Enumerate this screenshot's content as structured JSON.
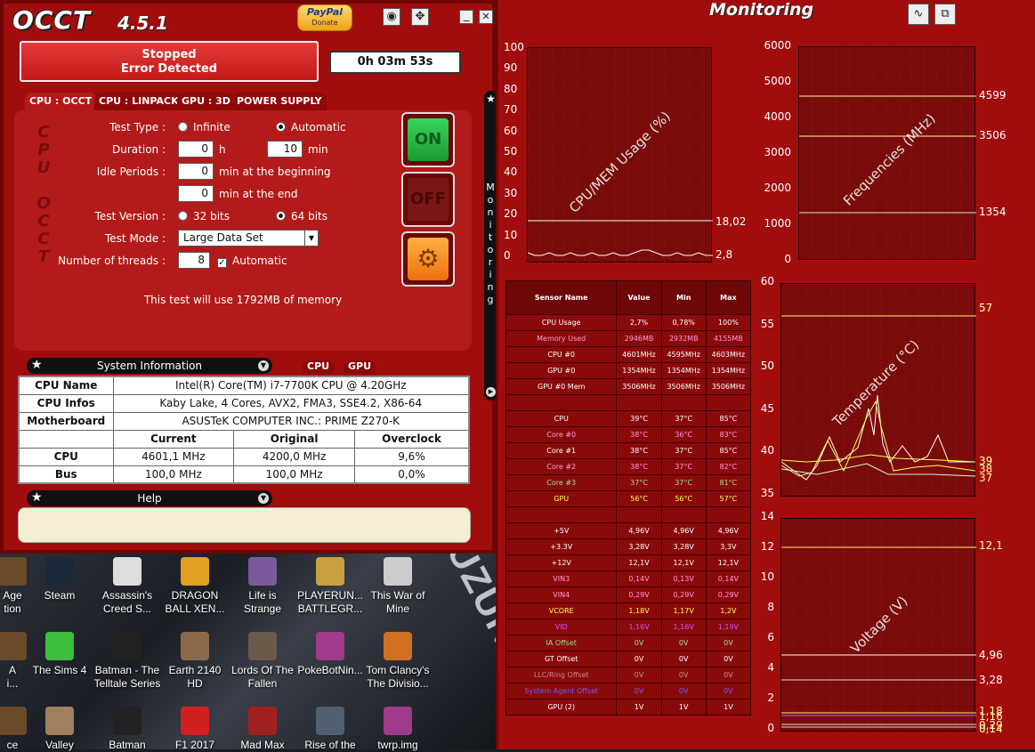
{
  "app": {
    "logo": "OCCT",
    "version": "4.5.1",
    "paypal": {
      "brand": "PayPal",
      "label": "Donate"
    },
    "status": {
      "line1": "Stopped",
      "line2": "Error Detected"
    },
    "timer": "0h 03m 53s",
    "tabs": [
      "CPU : OCCT",
      "CPU : LINPACK",
      "GPU : 3D",
      "POWER SUPPLY"
    ],
    "side_title": "CPU OCCT",
    "form": {
      "test_type_label": "Test Type :",
      "test_type_options": [
        "Infinite",
        "Automatic"
      ],
      "duration_label": "Duration :",
      "duration_hours": "0",
      "duration_h_unit": "h",
      "duration_minutes": "10",
      "duration_min_unit": "min",
      "idle_label": "Idle Periods :",
      "idle_begin": "0",
      "idle_begin_unit": "min at the beginning",
      "idle_end": "0",
      "idle_end_unit": "min at the end",
      "version_label": "Test Version :",
      "version_options": [
        "32 bits",
        "64 bits"
      ],
      "mode_label": "Test Mode :",
      "mode_value": "Large Data Set",
      "threads_label": "Number of threads :",
      "threads_value": "8",
      "threads_auto": "Automatic"
    },
    "buttons": {
      "on": "ON",
      "off": "OFF"
    },
    "memory_note": "This test will use 1792MB of memory",
    "sysinfo": {
      "title": "System Information",
      "tabs": [
        "CPU",
        "GPU"
      ],
      "rows": [
        [
          "CPU Name",
          "Intel(R) Core(TM) i7-7700K CPU @ 4.20GHz"
        ],
        [
          "CPU Infos",
          "Kaby Lake, 4 Cores, AVX2, FMA3, SSE4.2, X86-64"
        ],
        [
          "Motherboard",
          "ASUSTeK COMPUTER INC.: PRIME Z270-K"
        ]
      ],
      "clock_headers": [
        "Current",
        "Original",
        "Overclock"
      ],
      "clock_rows": [
        [
          "CPU",
          "4601,1 MHz",
          "4200,0 MHz",
          "9,6%"
        ],
        [
          "Bus",
          "100,0 MHz",
          "100,0 MHz",
          "0,0%"
        ]
      ]
    },
    "help_title": "Help",
    "monitoring_vertical": "Monitoring"
  },
  "monitor": {
    "title": "Monitoring",
    "charts": [
      {
        "title": "CPU/MEM Usage (%)",
        "yticks": [
          "100",
          "90",
          "80",
          "70",
          "60",
          "50",
          "40",
          "30",
          "20",
          "10",
          "0"
        ],
        "labels": [
          "18,02",
          "2,8"
        ]
      },
      {
        "title": "Frequencies (MHz)",
        "yticks": [
          "6000",
          "5000",
          "4000",
          "3000",
          "2000",
          "1000",
          "0"
        ],
        "labels": [
          "4599",
          "3506",
          "1354"
        ]
      },
      {
        "title": "Temperature (°C)",
        "yticks": [
          "60",
          "55",
          "50",
          "45",
          "40",
          "35"
        ],
        "labels": [
          "57",
          "39",
          "38",
          "37"
        ]
      },
      {
        "title": "Voltage (V)",
        "yticks": [
          "14",
          "12",
          "10",
          "8",
          "6",
          "4",
          "2",
          "0"
        ],
        "labels": [
          "12,1",
          "4,96",
          "3,28",
          "1,18",
          "1,16",
          "0,29",
          "0,14"
        ]
      }
    ],
    "table": {
      "headers": [
        "Sensor Name",
        "Value",
        "Min",
        "Max"
      ],
      "rows": [
        {
          "c": "",
          "v": [
            "CPU Usage",
            "2,7%",
            "0,78%",
            "100%"
          ]
        },
        {
          "c": "c-pink",
          "v": [
            "Memory Used",
            "2946MB",
            "2932MB",
            "4155MB"
          ]
        },
        {
          "c": "",
          "v": [
            "CPU #0",
            "4601MHz",
            "4595MHz",
            "4603MHz"
          ]
        },
        {
          "c": "",
          "v": [
            "GPU #0",
            "1354MHz",
            "1354MHz",
            "1354MHz"
          ]
        },
        {
          "c": "",
          "v": [
            "GPU #0 Mem",
            "3506MHz",
            "3506MHz",
            "3506MHz"
          ]
        },
        {
          "c": "",
          "v": [
            "",
            "",
            "",
            ""
          ]
        },
        {
          "c": "",
          "v": [
            "CPU",
            "39°C",
            "37°C",
            "85°C"
          ]
        },
        {
          "c": "c-pink",
          "v": [
            "Core #0",
            "38°C",
            "36°C",
            "83°C"
          ]
        },
        {
          "c": "",
          "v": [
            "Core #1",
            "38°C",
            "37°C",
            "85°C"
          ]
        },
        {
          "c": "c-pink",
          "v": [
            "Core #2",
            "38°C",
            "37°C",
            "82°C"
          ]
        },
        {
          "c": "c-green",
          "v": [
            "Core #3",
            "37°C",
            "37°C",
            "81°C"
          ]
        },
        {
          "c": "c-yellow",
          "v": [
            "GPU",
            "56°C",
            "56°C",
            "57°C"
          ]
        },
        {
          "c": "",
          "v": [
            "",
            "",
            "",
            ""
          ]
        },
        {
          "c": "",
          "v": [
            "+5V",
            "4,96V",
            "4,96V",
            "4,96V"
          ]
        },
        {
          "c": "",
          "v": [
            "+3.3V",
            "3,28V",
            "3,28V",
            "3,3V"
          ]
        },
        {
          "c": "",
          "v": [
            "+12V",
            "12,1V",
            "12,1V",
            "12,1V"
          ]
        },
        {
          "c": "c-pink",
          "v": [
            "VIN3",
            "0,14V",
            "0,13V",
            "0,14V"
          ]
        },
        {
          "c": "c-pink",
          "v": [
            "VIN4",
            "0,29V",
            "0,29V",
            "0,29V"
          ]
        },
        {
          "c": "c-yellow",
          "v": [
            "VCORE",
            "1,18V",
            "1,17V",
            "1,2V"
          ]
        },
        {
          "c": "c-purple",
          "v": [
            "VID",
            "1,16V",
            "1,16V",
            "1,19V"
          ]
        },
        {
          "c": "c-green",
          "v": [
            "IA Offset",
            "0V",
            "0V",
            "0V"
          ]
        },
        {
          "c": "",
          "v": [
            "GT Offset",
            "0V",
            "0V",
            "0V"
          ]
        },
        {
          "c": "c-dim",
          "v": [
            "LLC/Ring Offset",
            "0V",
            "0V",
            "0V"
          ]
        },
        {
          "c": "c-blue",
          "v": [
            "System Agent Offset",
            "0V",
            "0V",
            "0V"
          ]
        },
        {
          "c": "",
          "v": [
            "GPU (2)",
            "1V",
            "1V",
            "1V"
          ]
        }
      ]
    }
  },
  "desktop": {
    "suzuki": "SUZUKI",
    "icons": [
      {
        "label": "Age\ntion",
        "color": "#6b4a2a"
      },
      {
        "label": "Steam",
        "color": "#1b2838"
      },
      {
        "label": "Assassin's\nCreed S...",
        "color": "#ddd"
      },
      {
        "label": "DRAGON\nBALL XEN...",
        "color": "#e0a020"
      },
      {
        "label": "Life is\nStrange",
        "color": "#7a5a9a"
      },
      {
        "label": "PLAYERUN...\nBATTLEGR...",
        "color": "#c8a040"
      },
      {
        "label": "This War of\nMine",
        "color": "#ccc"
      },
      {
        "label": "A\ni...",
        "color": "#6b4a2a"
      },
      {
        "label": "The Sims 4",
        "color": "#3cbf3c"
      },
      {
        "label": "Batman - The\nTelltale Series",
        "color": "#222"
      },
      {
        "label": "Earth 2140\nHD",
        "color": "#8a6a4a"
      },
      {
        "label": "Lords Of The\nFallen",
        "color": "#6a5a4a"
      },
      {
        "label": "PokeBotNin...",
        "color": "#a03a8a"
      },
      {
        "label": "Tom Clancy's\nThe Divisio...",
        "color": "#d07020"
      },
      {
        "label": "ce",
        "color": "#6b4a2a"
      },
      {
        "label": "Valley",
        "color": "#a08060"
      },
      {
        "label": "Batman",
        "color": "#222"
      },
      {
        "label": "F1 2017",
        "color": "#d02020"
      },
      {
        "label": "Mad Max",
        "color": "#a02020"
      },
      {
        "label": "Rise of the",
        "color": "#506070"
      },
      {
        "label": "twrp.img",
        "color": "#a03a8a"
      }
    ]
  }
}
